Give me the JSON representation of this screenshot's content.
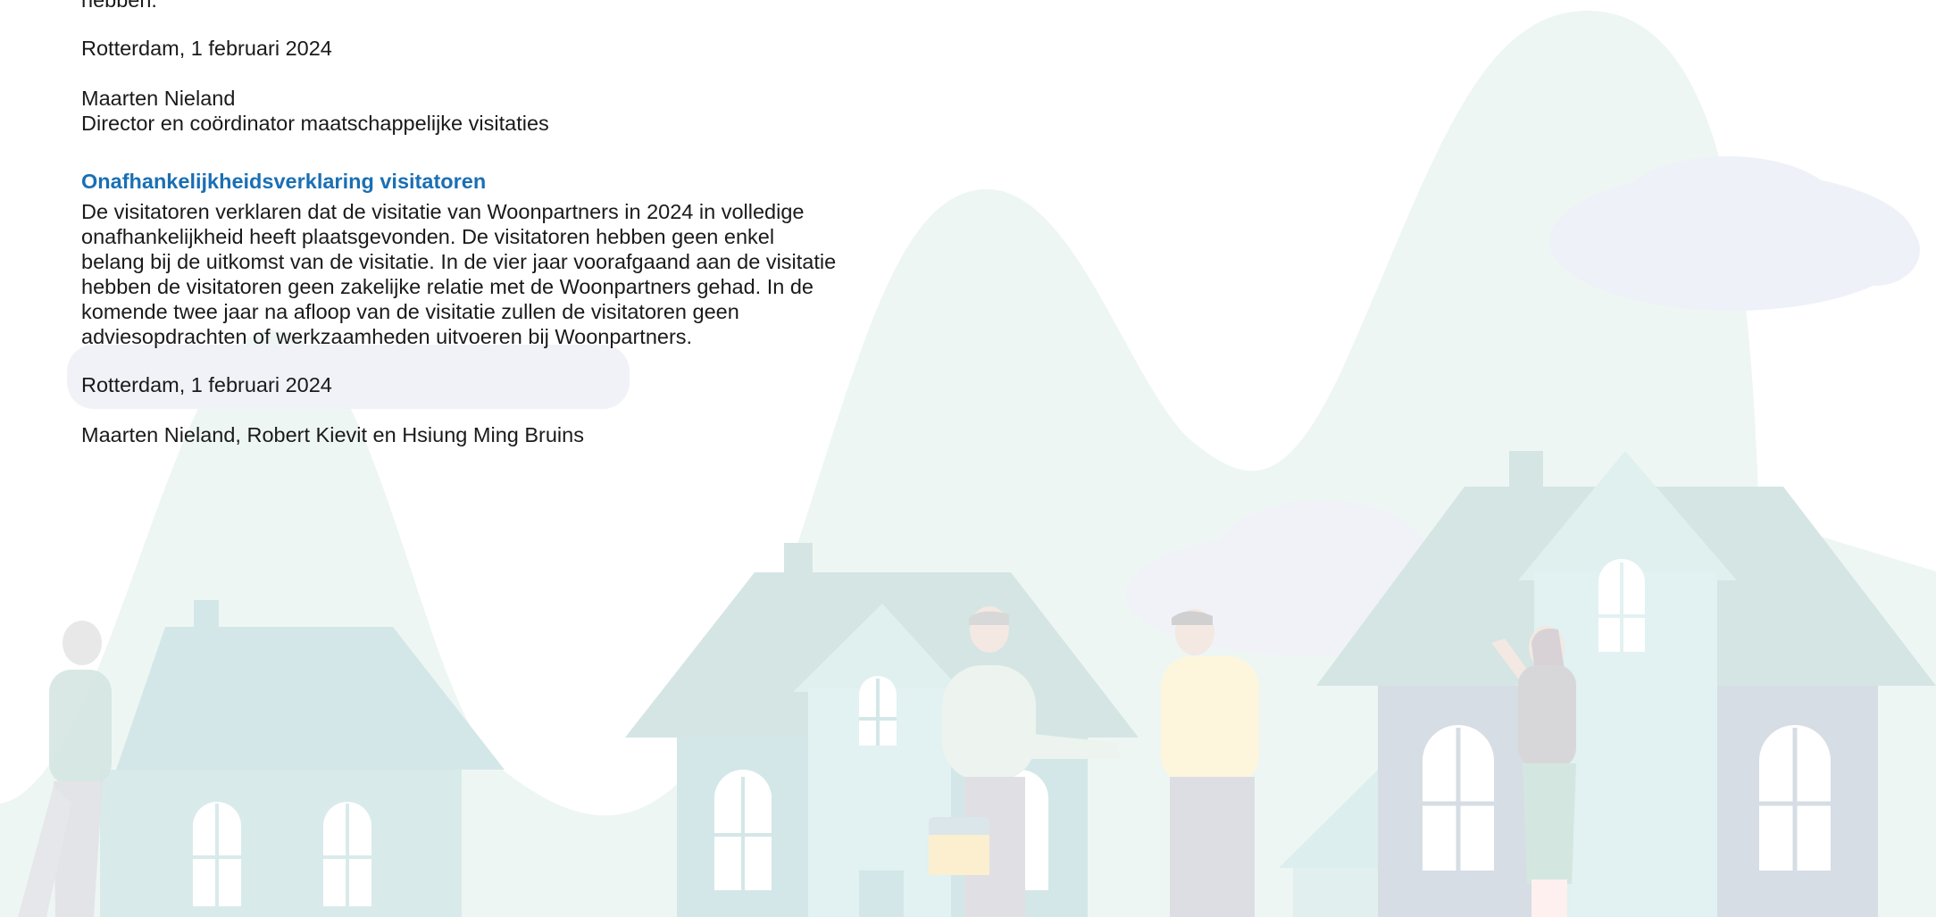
{
  "document": {
    "intro_tail": "hebben.",
    "signature1": {
      "place_date": "Rotterdam, 1 februari 2024",
      "name": "Maarten Nieland",
      "role": "Director en coördinator maatschappelijke visitaties"
    },
    "section": {
      "heading": "Onafhankelijkheidsverklaring visitatoren",
      "lines": [
        "De visitatoren verklaren dat de visitatie van Woonpartners in 2024 in volledige",
        "onafhankelijkheid heeft plaatsgevonden. De visitatoren hebben geen enkel",
        "belang bij de uitkomst van de visitatie. In de vier jaar voorafgaand aan de visitatie",
        "hebben de visitatoren geen zakelijke relatie met de Woonpartners gehad. In de",
        "komende twee jaar na afloop van de visitatie zullen de visitatoren geen",
        "adviesopdrachten of werkzaamheden uitvoeren bij Woonpartners."
      ]
    },
    "signature2": {
      "place_date": "Rotterdam, 1 februari 2024",
      "names": "Maarten Nieland, Robert Kievit en Hsiung Ming Bruins"
    }
  },
  "colors": {
    "heading": "#1a6fb4",
    "hills": "#eef6f3",
    "cloud": "#eef1f8",
    "house_teal": "#d4e7e8",
    "house_grey": "#d6dde4"
  }
}
